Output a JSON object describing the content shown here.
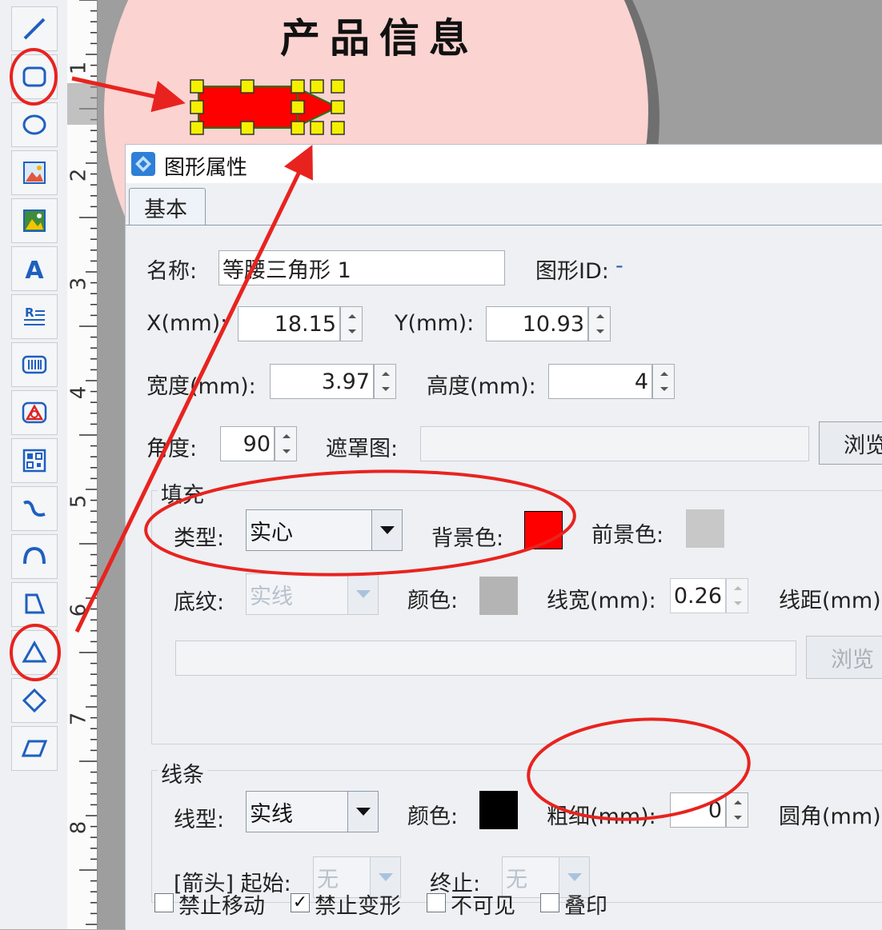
{
  "label": {
    "title": "产品信息"
  },
  "ruler": {
    "numbers": [
      "1",
      "2",
      "3",
      "4",
      "5",
      "6",
      "7",
      "8"
    ]
  },
  "toolbar": {
    "tools": [
      "line-icon",
      "rounded-rect-icon",
      "ellipse-icon",
      "image-icon",
      "picture-icon",
      "text-icon",
      "rich-text-icon",
      "barcode-icon",
      "graphic-icon",
      "qr-code-icon",
      "curve-icon",
      "arc-icon",
      "polygon-icon",
      "triangle-icon",
      "diamond-icon",
      "parallelogram-icon"
    ],
    "text_icon_glyph": "A"
  },
  "dialog": {
    "title": "图形属性",
    "tab": "基本",
    "name_label": "名称:",
    "name_value": "等腰三角形 1",
    "id_label": "图形ID:",
    "id_value": "-",
    "x_label": "X(mm):",
    "x_value": "18.15",
    "y_label": "Y(mm):",
    "y_value": "10.93",
    "width_label": "宽度(mm):",
    "width_value": "3.97",
    "height_label": "高度(mm):",
    "height_value": "4",
    "angle_label": "角度:",
    "angle_value": "90",
    "mask_label": "遮罩图:",
    "mask_value": "",
    "browse_label": "浏览",
    "fill": {
      "group_label": "填充",
      "type_label": "类型:",
      "type_value": "实心",
      "bg_label": "背景色:",
      "bg_color": "#ff0000",
      "fg_label": "前景色:",
      "fg_color": "#c8c8c8",
      "pattern_label": "底纹:",
      "pattern_value": "实线",
      "color_label": "颜色:",
      "pattern_color": "#b4b4b4",
      "linewidth_label": "线宽(mm):",
      "linewidth_value": "0.26",
      "spacing_label": "线距(mm):",
      "path_value": "",
      "browse_label": "浏览"
    },
    "line": {
      "group_label": "线条",
      "type_label": "线型:",
      "type_value": "实线",
      "color_label": "颜色:",
      "color": "#000000",
      "thickness_label": "粗细(mm):",
      "thickness_value": "0",
      "corner_label": "圆角(mm):",
      "arrow_label": "[箭头] 起始:",
      "arrow_start": "无",
      "arrow_end_label": "终止:",
      "arrow_end": "无"
    },
    "checkboxes": [
      {
        "label": "禁止移动",
        "checked": false
      },
      {
        "label": "禁止变形",
        "checked": true
      },
      {
        "label": "不可见",
        "checked": false
      },
      {
        "label": "叠印",
        "checked": false
      }
    ]
  },
  "colors": {
    "annotation": "#e8231f",
    "selection_handle": "#f5f000",
    "shape_fill": "#ff0000"
  }
}
